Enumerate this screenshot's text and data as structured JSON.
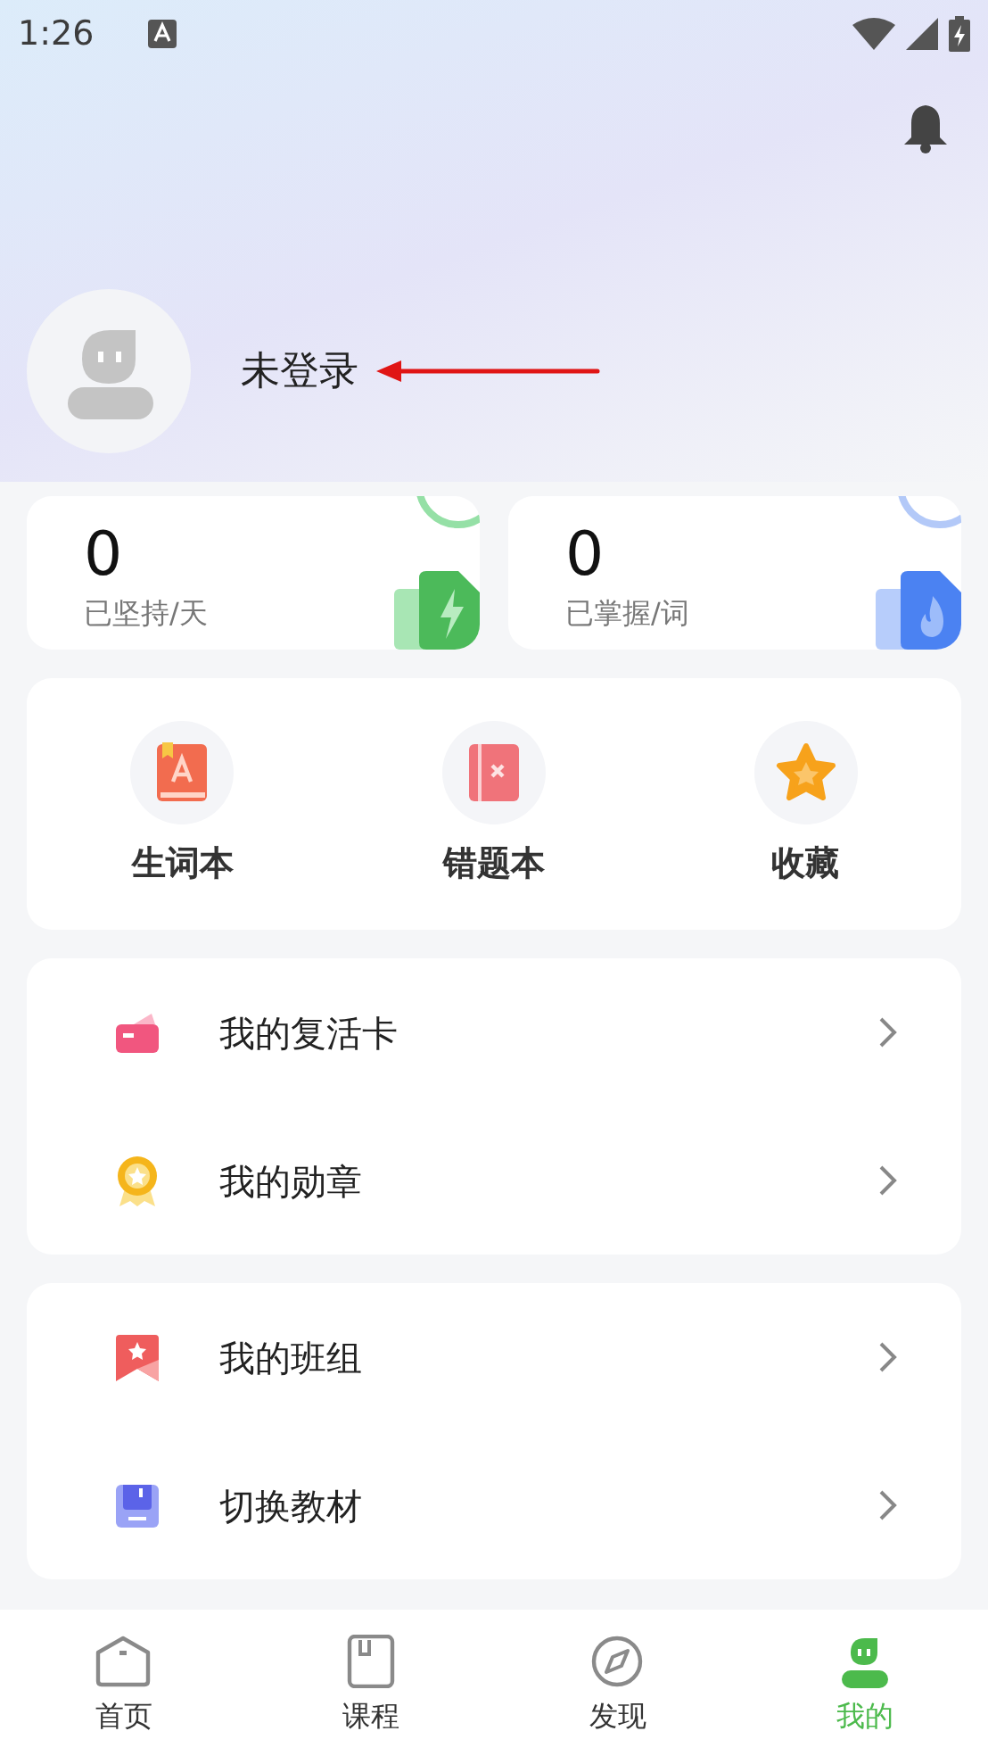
{
  "status_bar": {
    "time": "1:26"
  },
  "profile": {
    "name": "未登录"
  },
  "stats": [
    {
      "value": "0",
      "label": "已坚持/天",
      "kind": "days"
    },
    {
      "value": "0",
      "label": "已掌握/词",
      "kind": "words"
    }
  ],
  "shortcuts": [
    {
      "label": "生词本",
      "kind": "vocab"
    },
    {
      "label": "错题本",
      "kind": "mistakes"
    },
    {
      "label": "收藏",
      "kind": "favorites"
    }
  ],
  "menu_groups": [
    {
      "items": [
        {
          "label": "我的复活卡",
          "kind": "card"
        },
        {
          "label": "我的勋章",
          "kind": "medal"
        }
      ]
    },
    {
      "items": [
        {
          "label": "我的班组",
          "kind": "class"
        },
        {
          "label": "切换教材",
          "kind": "textbook"
        }
      ]
    }
  ],
  "bottom_nav": [
    {
      "label": "首页",
      "kind": "home",
      "selected": false
    },
    {
      "label": "课程",
      "kind": "course",
      "selected": false
    },
    {
      "label": "发现",
      "kind": "discover",
      "selected": false
    },
    {
      "label": "我的",
      "kind": "me",
      "selected": true
    }
  ]
}
